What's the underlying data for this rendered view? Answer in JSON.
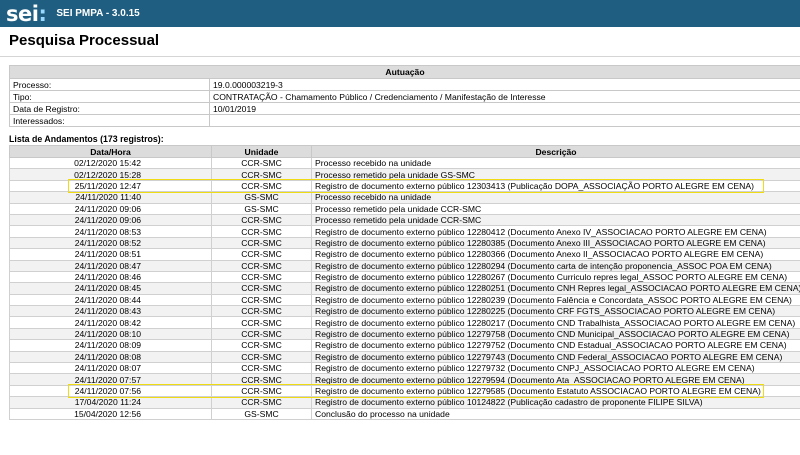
{
  "header": {
    "logo": "sei",
    "logo_colon": ":",
    "system_version": "SEI PMPA - 3.0.15"
  },
  "page_title": "Pesquisa Processual",
  "autuacao": {
    "heading": "Autuação",
    "rows": [
      {
        "label": "Processo:",
        "value": "19.0.000003219-3"
      },
      {
        "label": "Tipo:",
        "value": "CONTRATAÇÃO - Chamamento Público / Credenciamento / Manifestação de Interesse"
      },
      {
        "label": "Data de Registro:",
        "value": "10/01/2019"
      },
      {
        "label": "Interessados:",
        "value": ""
      }
    ]
  },
  "andamentos": {
    "caption": "Lista de Andamentos (173 registros):",
    "columns": [
      "Data/Hora",
      "Unidade",
      "Descrição"
    ],
    "rows": [
      [
        "02/12/2020 15:42",
        "CCR-SMC",
        "Processo recebido na unidade"
      ],
      [
        "02/12/2020 15:28",
        "CCR-SMC",
        "Processo remetido pela unidade GS-SMC"
      ],
      [
        "25/11/2020 12:47",
        "CCR-SMC",
        "Registro de documento externo público 12303413 (Publicação DOPA_ASSOCIAÇÃO PORTO ALEGRE EM CENA)"
      ],
      [
        "24/11/2020 11:40",
        "GS-SMC",
        "Processo recebido na unidade"
      ],
      [
        "24/11/2020 09:06",
        "GS-SMC",
        "Processo remetido pela unidade CCR-SMC"
      ],
      [
        "24/11/2020 09:06",
        "CCR-SMC",
        "Processo remetido pela unidade CCR-SMC"
      ],
      [
        "24/11/2020 08:53",
        "CCR-SMC",
        "Registro de documento externo público 12280412 (Documento Anexo IV_ASSOCIACAO PORTO ALEGRE EM CENA)"
      ],
      [
        "24/11/2020 08:52",
        "CCR-SMC",
        "Registro de documento externo público 12280385 (Documento Anexo III_ASSOCIACAO PORTO ALEGRE EM CENA)"
      ],
      [
        "24/11/2020 08:51",
        "CCR-SMC",
        "Registro de documento externo público 12280366 (Documento Anexo II_ASSOCIACAO PORTO ALEGRE EM CENA)"
      ],
      [
        "24/11/2020 08:47",
        "CCR-SMC",
        "Registro de documento externo público 12280294 (Documento carta de intenção proponencia_ASSOC POA EM CENA)"
      ],
      [
        "24/11/2020 08:46",
        "CCR-SMC",
        "Registro de documento externo público 12280267 (Documento Curriculo repres legal_ASSOC PORTO ALEGRE EM CENA)"
      ],
      [
        "24/11/2020 08:45",
        "CCR-SMC",
        "Registro de documento externo público 12280251 (Documento CNH Repres legal_ASSOCIACAO PORTO ALEGRE EM CENA)"
      ],
      [
        "24/11/2020 08:44",
        "CCR-SMC",
        "Registro de documento externo público 12280239 (Documento Falência e Concordata_ASSOC PORTO ALEGRE EM CENA)"
      ],
      [
        "24/11/2020 08:43",
        "CCR-SMC",
        "Registro de documento externo público 12280225 (Documento CRF FGTS_ASSOCIACAO PORTO ALEGRE EM CENA)"
      ],
      [
        "24/11/2020 08:42",
        "CCR-SMC",
        "Registro de documento externo público 12280217 (Documento CND Trabalhista_ASSOCIACAO PORTO ALEGRE EM CENA)"
      ],
      [
        "24/11/2020 08:10",
        "CCR-SMC",
        "Registro de documento externo público 12279758 (Documento CND Municipal_ASSOCIACAO PORTO ALEGRE EM CENA)"
      ],
      [
        "24/11/2020 08:09",
        "CCR-SMC",
        "Registro de documento externo público 12279752 (Documento CND Estadual_ASSOCIACAO PORTO ALEGRE EM CENA)"
      ],
      [
        "24/11/2020 08:08",
        "CCR-SMC",
        "Registro de documento externo público 12279743 (Documento CND Federal_ASSOCIACAO PORTO ALEGRE EM CENA)"
      ],
      [
        "24/11/2020 08:07",
        "CCR-SMC",
        "Registro de documento externo público 12279732 (Documento CNPJ_ASSOCIACAO PORTO ALEGRE EM CENA)"
      ],
      [
        "24/11/2020 07:57",
        "CCR-SMC",
        "Registro de documento externo público 12279594 (Documento Ata_ASSOCIACAO PORTO ALEGRE EM CENA)"
      ],
      [
        "24/11/2020 07:56",
        "CCR-SMC",
        "Registro de documento externo público 12279585 (Documento Estatuto ASSOCIACAO PORTO ALEGRE EM CENA)"
      ],
      [
        "17/04/2020 11:24",
        "CCR-SMC",
        "Registro de documento externo público 10124822 (Publicação cadastro de proponente FILIPE SILVA)"
      ],
      [
        "15/04/2020 12:56",
        "GS-SMC",
        "Conclusão do processo na unidade"
      ]
    ]
  }
}
